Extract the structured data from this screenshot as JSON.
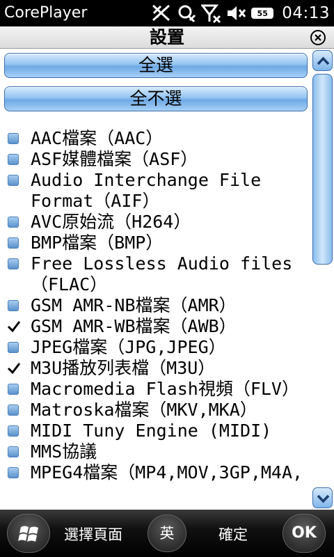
{
  "status_bar": {
    "app_title": "CorePlayer",
    "battery_label": "55",
    "time": "04:13",
    "icons": [
      "signal-off-icon",
      "sync-icon",
      "network-off-icon",
      "volume-muted-icon",
      "battery-icon"
    ]
  },
  "dialog": {
    "title": "設置",
    "close_icon": "close-icon"
  },
  "buttons": {
    "select_all": "全選",
    "select_none": "全不選"
  },
  "file_types": [
    {
      "label": "AAC檔案（AAC）",
      "checked": false
    },
    {
      "label": "ASF媒體檔案（ASF）",
      "checked": false
    },
    {
      "label": "Audio Interchange File Format（AIF）",
      "checked": false
    },
    {
      "label": "AVC原始流（H264）",
      "checked": false
    },
    {
      "label": "BMP檔案（BMP）",
      "checked": false
    },
    {
      "label": "Free Lossless Audio files（FLAC）",
      "checked": false
    },
    {
      "label": "GSM AMR-NB檔案（AMR）",
      "checked": false
    },
    {
      "label": "GSM AMR-WB檔案（AWB）",
      "checked": true
    },
    {
      "label": "JPEG檔案（JPG,JPEG）",
      "checked": false
    },
    {
      "label": "M3U播放列表檔（M3U）",
      "checked": true
    },
    {
      "label": "Macromedia Flash視頻（FLV）",
      "checked": false
    },
    {
      "label": "Matroska檔案（MKV,MKA）",
      "checked": false
    },
    {
      "label": "MIDI Tuny Engine (MIDI)",
      "checked": false
    },
    {
      "label": "MMS協議",
      "checked": false
    },
    {
      "label": "MPEG4檔案（MP4,MOV,3GP,M4A,",
      "checked": false
    }
  ],
  "bottom_bar": {
    "start_icon": "windows-flag-icon",
    "left_softkey": "選擇頁面",
    "ime": "英",
    "right_softkey": "確定",
    "ok": "OK"
  },
  "colors": {
    "button_blue": "#93c4f1",
    "status_bar": "#000000",
    "bottom_bar": "#111111"
  }
}
